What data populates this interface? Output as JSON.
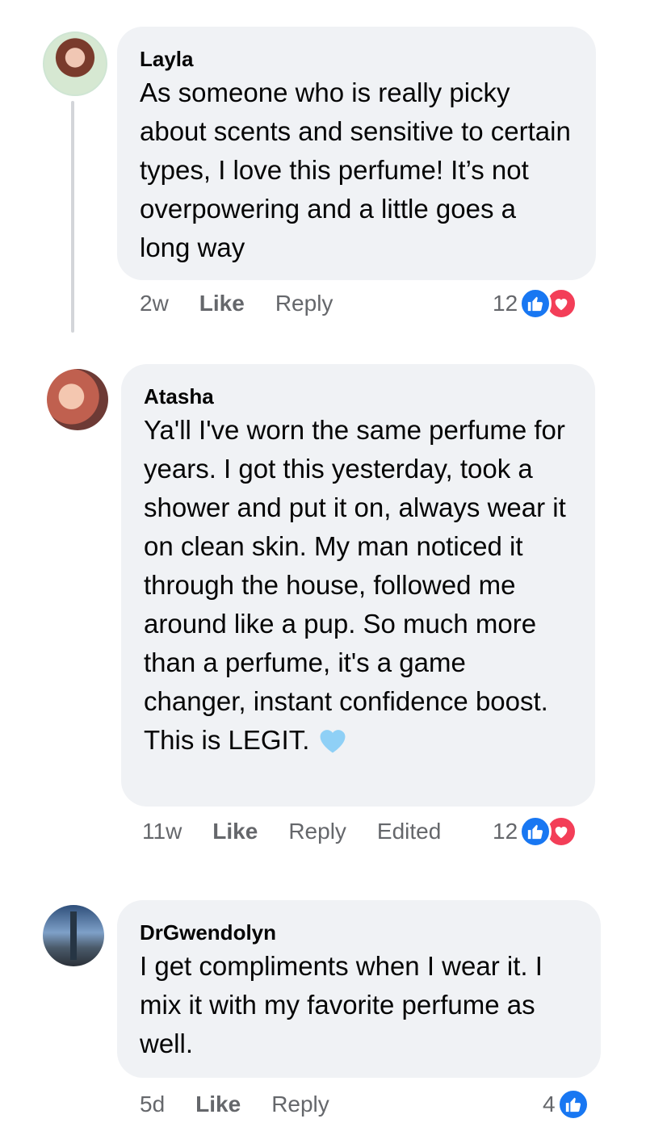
{
  "comments": [
    {
      "author": "Layla",
      "text": "As someone who is really picky about scents and sensitive to certain types, I love this perfume! It’s not overpowering and a little goes a long way",
      "time": "2w",
      "like_label": "Like",
      "reply_label": "Reply",
      "reaction_count": "12",
      "reactions": [
        "like-icon",
        "love-icon"
      ]
    },
    {
      "author": "Atasha",
      "text": "Ya'll I've worn the same perfume for years. I got this yesterday, took a shower and put it on, always wear it on clean skin. My man noticed it through the house, followed me around like a pup. So much more than a perfume, it's a game changer, instant confidence boost. This is LEGIT.",
      "emoji": "light-blue-heart-icon",
      "time": "11w",
      "like_label": "Like",
      "reply_label": "Reply",
      "edited_label": "Edited",
      "reaction_count": "12",
      "reactions": [
        "like-icon",
        "love-icon"
      ]
    },
    {
      "author": "DrGwendolyn",
      "text": "I get compliments when I wear it. I mix it with my favorite perfume as well.",
      "time": "5d",
      "like_label": "Like",
      "reply_label": "Reply",
      "reaction_count": "4",
      "reactions": [
        "like-icon"
      ]
    }
  ],
  "colors": {
    "bubble": "#f0f2f5",
    "meta_text": "#65676b",
    "like_blue": "#1877f2",
    "love_red": "#f33e58"
  }
}
